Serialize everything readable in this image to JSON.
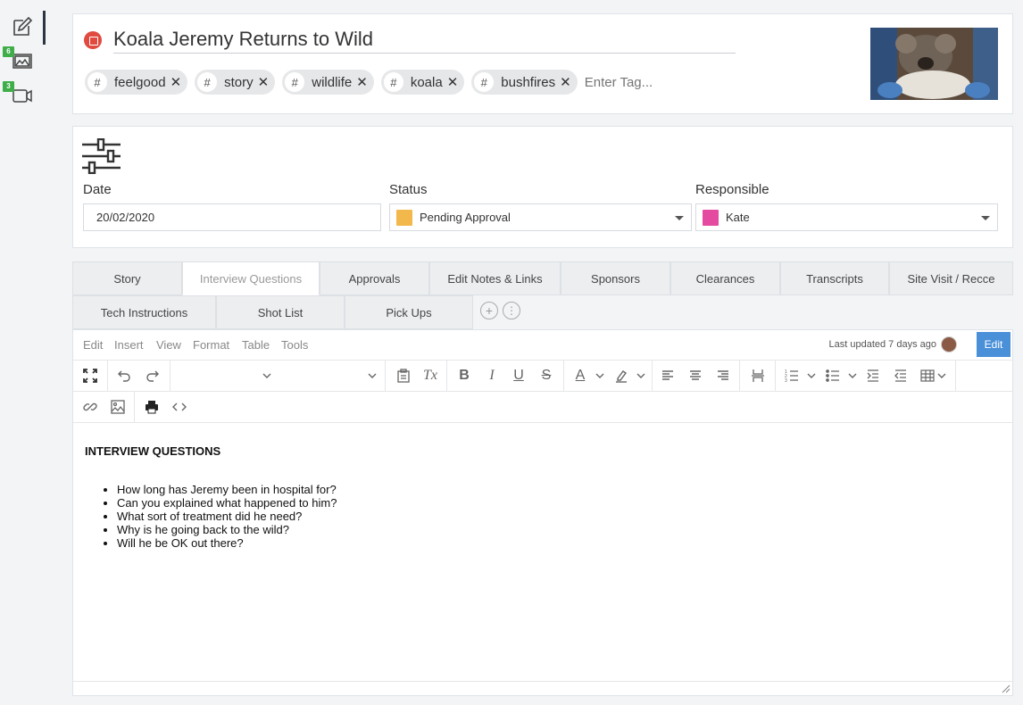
{
  "rail": {
    "images_badge": "6",
    "videos_badge": "3"
  },
  "story": {
    "title": "Koala Jeremy Returns to Wild",
    "tags": [
      "feelgood",
      "story",
      "wildlife",
      "koala",
      "bushfires"
    ],
    "tag_placeholder": "Enter Tag..."
  },
  "meta": {
    "date_label": "Date",
    "date_value": "20/02/2020",
    "status_label": "Status",
    "status_value": "Pending Approval",
    "status_color": "#f2b84b",
    "responsible_label": "Responsible",
    "responsible_value": "Kate",
    "responsible_color": "#e44ba0"
  },
  "tabs": {
    "row1": [
      "Story",
      "Interview Questions",
      "Approvals",
      "Edit Notes & Links",
      "Sponsors",
      "Clearances",
      "Transcripts",
      "Site Visit / Recce"
    ],
    "row2": [
      "Tech Instructions",
      "Shot List",
      "Pick Ups"
    ],
    "active": "Interview Questions"
  },
  "editor": {
    "menu": [
      "Edit",
      "Insert",
      "View",
      "Format",
      "Table",
      "Tools"
    ],
    "last_updated": "Last updated 7 days ago",
    "edit_label": "Edit",
    "heading": "INTERVIEW QUESTIONS",
    "questions": [
      "How long has Jeremy been in hospital for?",
      "Can you explained what happened to him?",
      "What sort of treatment did he need?",
      "Why is he going back to the wild?",
      "Will he be OK out there?"
    ]
  }
}
